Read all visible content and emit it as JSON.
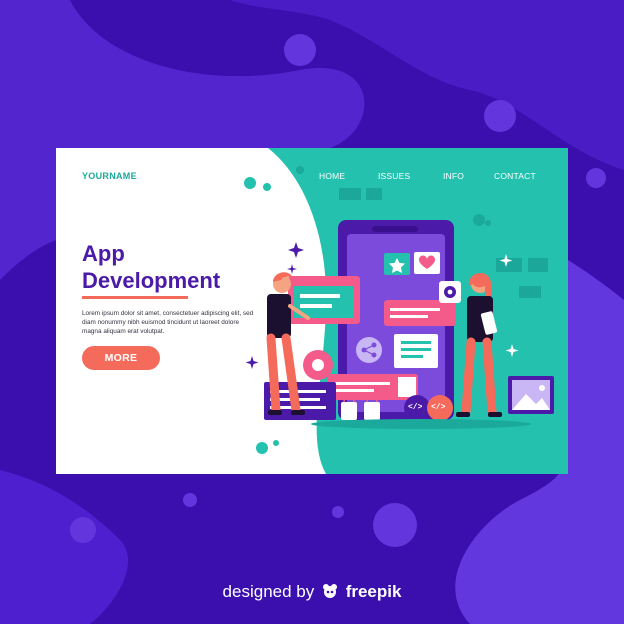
{
  "header": {
    "brand": "YOURNAME",
    "nav": [
      "HOME",
      "ISSUES",
      "INFO",
      "CONTACT"
    ]
  },
  "hero": {
    "title_line1": "App",
    "title_line2": "Development",
    "description": "Lorem ipsum dolor sit amet, consectetuer adipiscing elit, sed diam nonummy nibh euismod tincidunt ut laoreet dolore magna aliquam erat volutpat.",
    "button_label": "MORE"
  },
  "illustration": {
    "code_tag": "</>"
  },
  "footer": {
    "prefix": "designed by",
    "brand": "freepik"
  },
  "colors": {
    "background": "#3b0fb0",
    "teal": "#23c1ae",
    "purple": "#4b1aa8",
    "accent": "#f46b5b"
  }
}
